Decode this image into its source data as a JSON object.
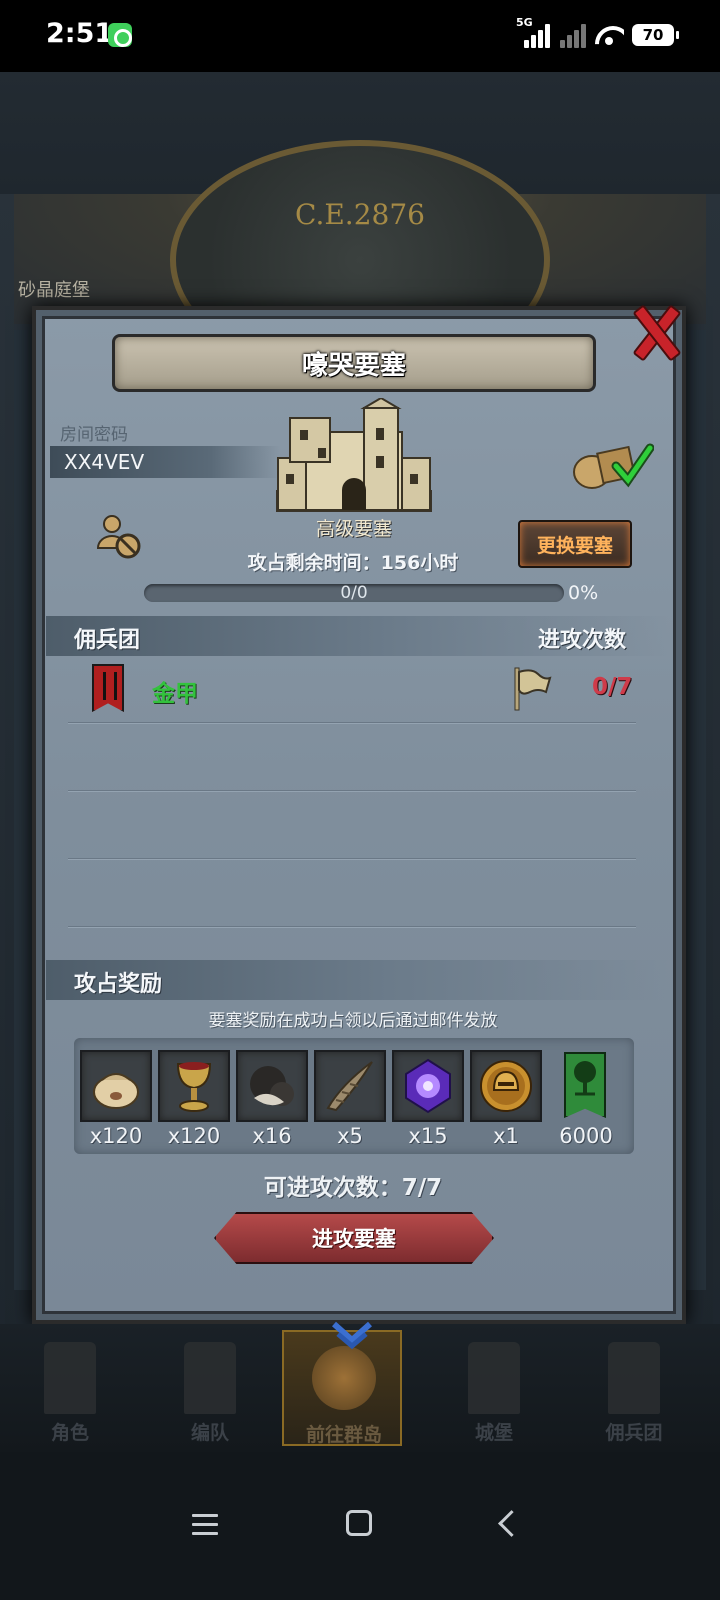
{
  "status_bar": {
    "time": "2:51",
    "network_tag": "5G",
    "battery": "70"
  },
  "background": {
    "era_text": "C.E.2876",
    "location_label": "砂晶庭堡"
  },
  "dialog": {
    "title": "嚎哭要塞",
    "room_code_label": "房间密码",
    "room_code": "XX4VEV",
    "fortress_level": "高级要塞",
    "change_button": "更换要塞",
    "timer_text": "攻占剩余时间：156小时",
    "progress": {
      "text": "0/0",
      "percent_text": "0%",
      "fraction": 0
    },
    "mercenary_header": "佣兵团",
    "attack_count_header": "进攻次数",
    "mercenaries": [
      {
        "name": "金甲",
        "attack_count": "0/7"
      }
    ],
    "rewards_header": "攻占奖励",
    "rewards_note": "要塞奖励在成功占领以后通过邮件发放",
    "rewards": [
      {
        "icon": "sack-icon",
        "qty": "x120"
      },
      {
        "icon": "goblet-icon",
        "qty": "x120"
      },
      {
        "icon": "truffle-icon",
        "qty": "x16"
      },
      {
        "icon": "horn-icon",
        "qty": "x5"
      },
      {
        "icon": "purple-gem-icon",
        "qty": "x15"
      },
      {
        "icon": "helmet-medal-icon",
        "qty": "x1"
      },
      {
        "icon": "tree-banner-icon",
        "qty": "6000"
      }
    ],
    "attempts_text": "可进攻次数：7/7",
    "attack_button": "进攻要塞"
  },
  "bottom_nav": [
    {
      "label": "角色",
      "icon": "knight-icon",
      "active": false
    },
    {
      "label": "编队",
      "icon": "helmet-icon",
      "active": false
    },
    {
      "label": "前往群岛",
      "icon": "compass-icon",
      "active": true
    },
    {
      "label": "城堡",
      "icon": "castle-icon",
      "active": false
    },
    {
      "label": "佣兵团",
      "icon": "mercenary-icon",
      "active": false
    }
  ],
  "colors": {
    "accent_red": "#c8232a",
    "merc_green": "#33c23d",
    "count_red": "#cf3b4a",
    "change_btn_text": "#ffb35c"
  }
}
